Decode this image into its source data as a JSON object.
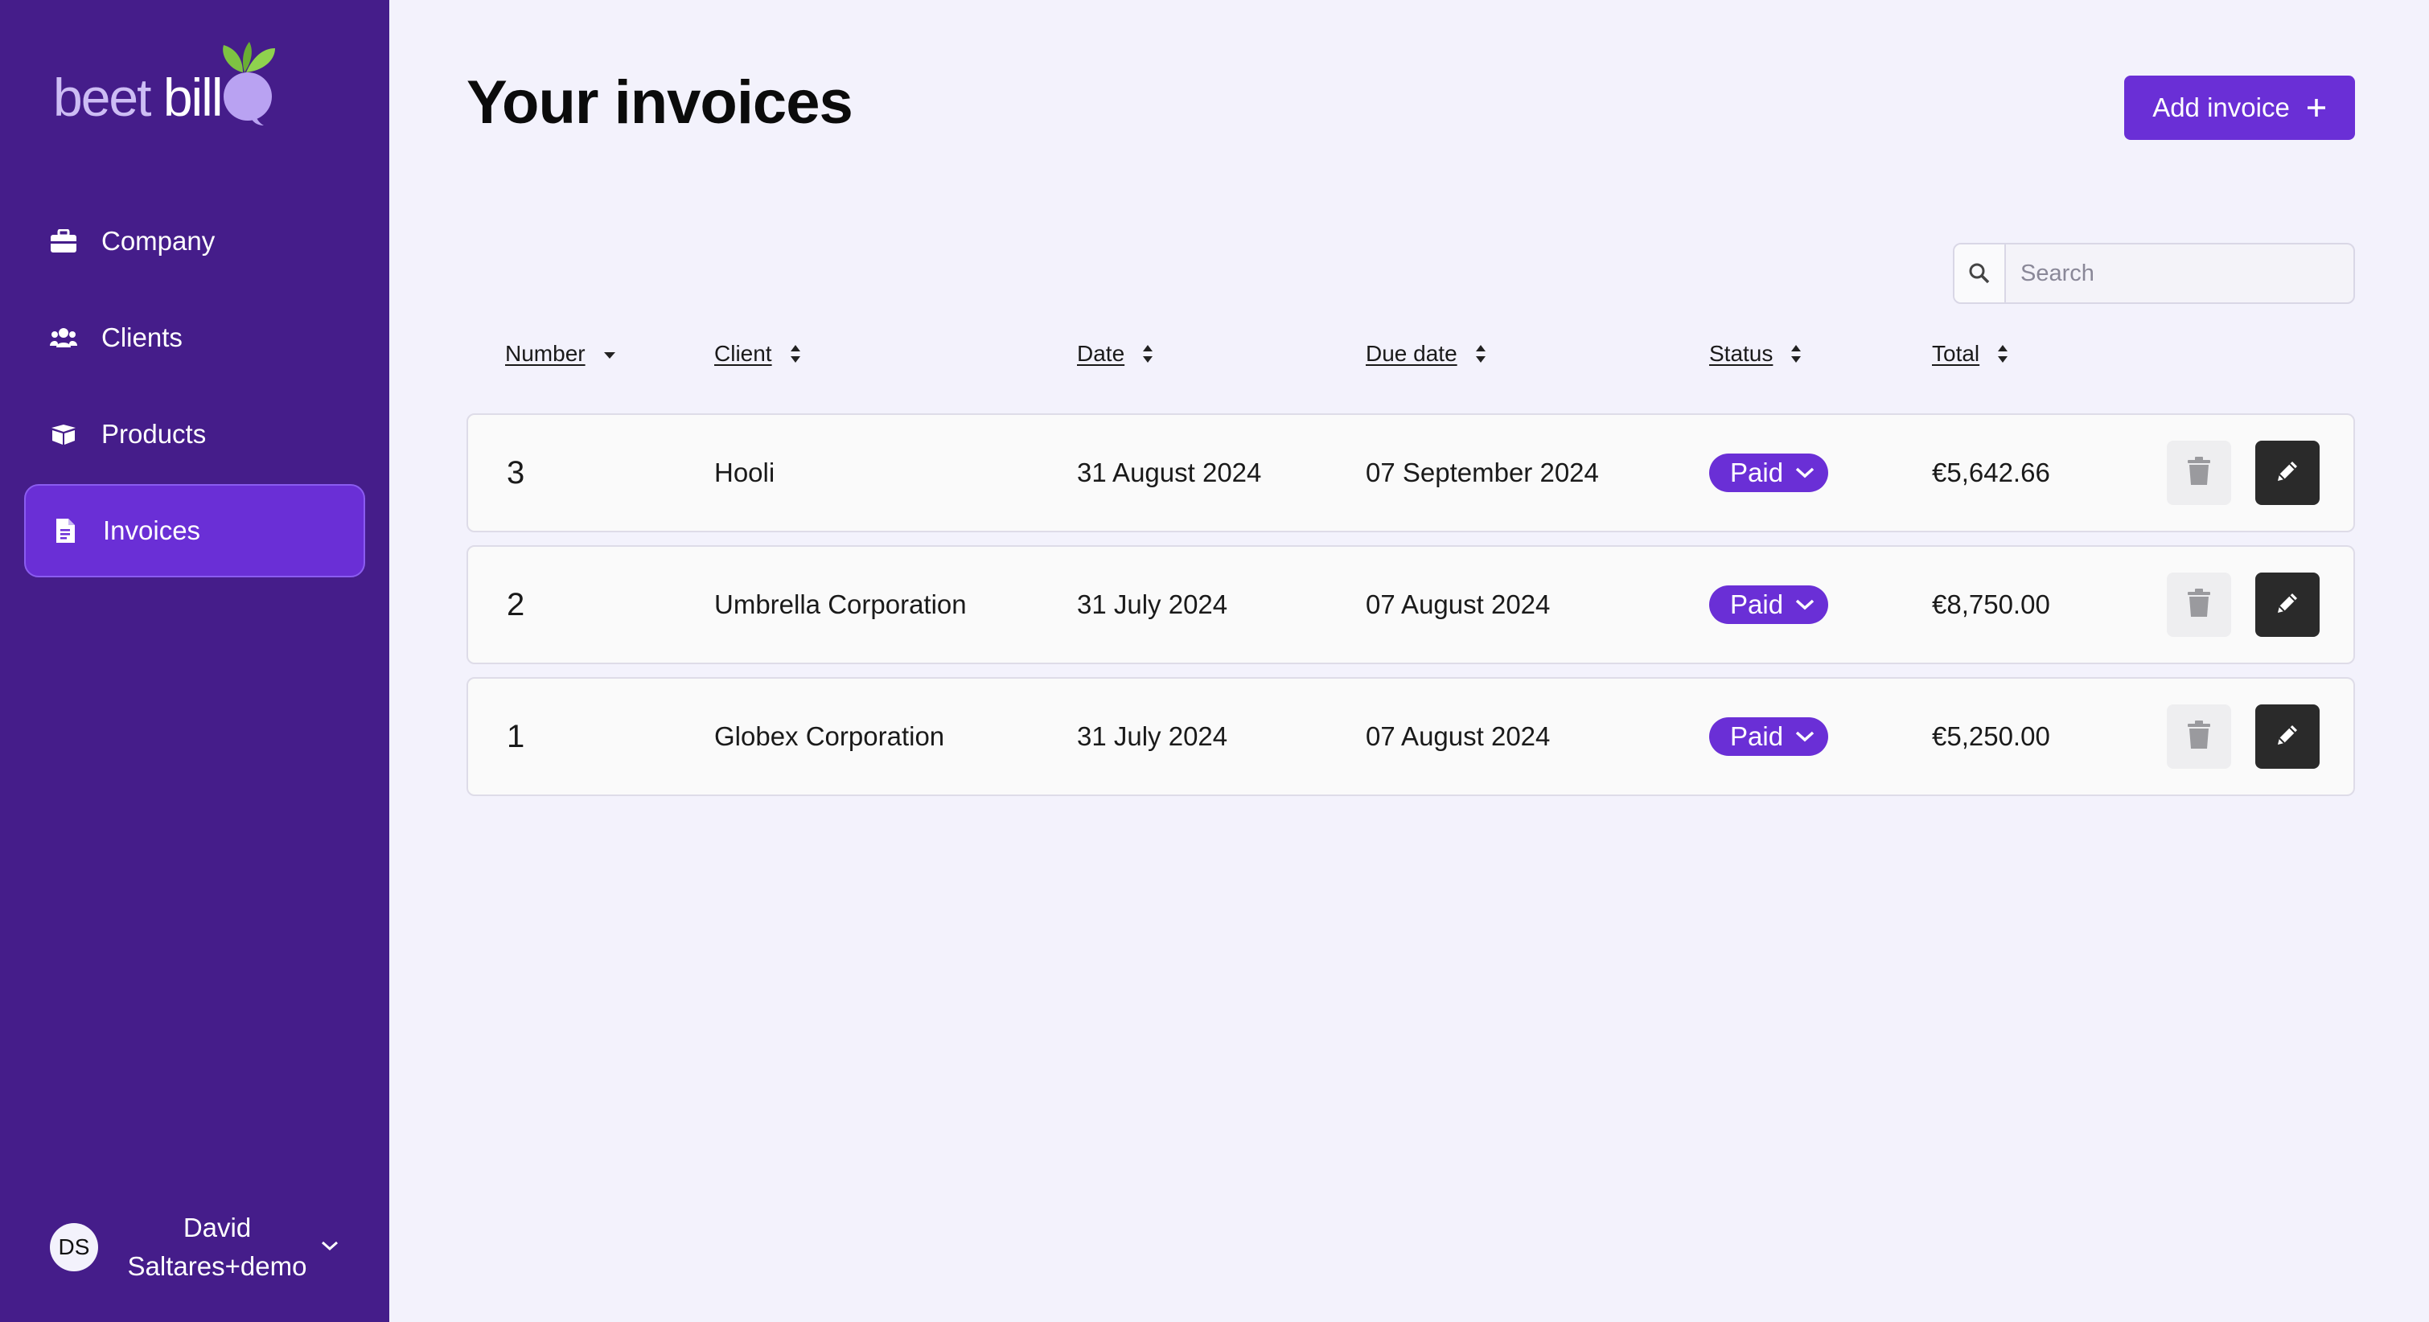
{
  "brand": {
    "word1": "beet",
    "word2": "bill"
  },
  "sidebar": {
    "items": [
      {
        "label": "Company",
        "icon": "briefcase-icon",
        "active": false
      },
      {
        "label": "Clients",
        "icon": "users-icon",
        "active": false
      },
      {
        "label": "Products",
        "icon": "box-icon",
        "active": false
      },
      {
        "label": "Invoices",
        "icon": "file-invoice-icon",
        "active": true
      }
    ],
    "user": {
      "initials": "DS",
      "name": "David Saltares+demo"
    }
  },
  "page": {
    "title": "Your invoices",
    "add_button": "Add invoice"
  },
  "search": {
    "placeholder": "Search",
    "value": ""
  },
  "table": {
    "columns": [
      "Number",
      "Client",
      "Date",
      "Due date",
      "Status",
      "Total"
    ],
    "sorted_column": "Number",
    "rows": [
      {
        "number": "3",
        "client": "Hooli",
        "date": "31 August 2024",
        "due": "07 September 2024",
        "status": "Paid",
        "total": "€5,642.66"
      },
      {
        "number": "2",
        "client": "Umbrella Corporation",
        "date": "31 July 2024",
        "due": "07 August 2024",
        "status": "Paid",
        "total": "€8,750.00"
      },
      {
        "number": "1",
        "client": "Globex Corporation",
        "date": "31 July 2024",
        "due": "07 August 2024",
        "status": "Paid",
        "total": "€5,250.00"
      }
    ]
  },
  "colors": {
    "sidebar_bg": "#451d8a",
    "accent": "#6a2fd6",
    "page_bg": "#f3f2fc",
    "edit_button": "#2a2a2a"
  }
}
